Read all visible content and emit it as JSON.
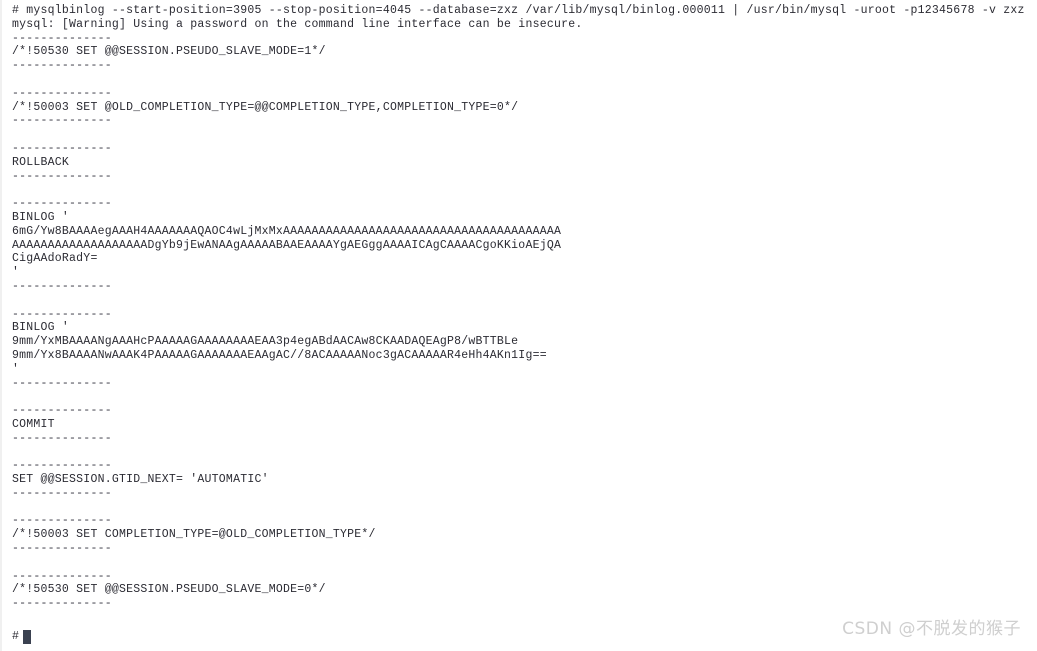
{
  "terminal": {
    "background_color": "#ffffff",
    "text_color": "#2b2b33",
    "cursor_color": "#3a4150",
    "prompt_symbol": "#",
    "lines": [
      "# mysqlbinlog --start-position=3905 --stop-position=4045 --database=zxz /var/lib/mysql/binlog.000011 | /usr/bin/mysql -uroot -p12345678 -v zxz",
      "mysql: [Warning] Using a password on the command line interface can be insecure.",
      "--------------",
      "/*!50530 SET @@SESSION.PSEUDO_SLAVE_MODE=1*/",
      "--------------",
      "",
      "--------------",
      "/*!50003 SET @OLD_COMPLETION_TYPE=@@COMPLETION_TYPE,COMPLETION_TYPE=0*/",
      "--------------",
      "",
      "--------------",
      "ROLLBACK",
      "--------------",
      "",
      "--------------",
      "BINLOG '",
      "6mG/Yw8BAAAAegAAAH4AAAAAAAQAOC4wLjMxMxAAAAAAAAAAAAAAAAAAAAAAAAAAAAAAAAAAAAAAA",
      "AAAAAAAAAAAAAAAAAAADgYb9jEwANAAgAAAAABAAEAAAAYgAEGggAAAAICAgCAAAACgoKKioAEjQA",
      "CigAAdoRadY=",
      "'",
      "--------------",
      "",
      "--------------",
      "BINLOG '",
      "9mm/YxMBAAAANgAAAHcPAAAAAGAAAAAAAAEAA3p4egABdAACAw8CKAADAQEAgP8/wBTTBLe",
      "9mm/Yx8BAAAANwAAAK4PAAAAAGAAAAAAAEAAgAC//8ACAAAAANoc3gACAAAAAR4eHh4AKn1Ig==",
      "'",
      "--------------",
      "",
      "--------------",
      "COMMIT",
      "--------------",
      "",
      "--------------",
      "SET @@SESSION.GTID_NEXT= 'AUTOMATIC'",
      "--------------",
      "",
      "--------------",
      "/*!50003 SET COMPLETION_TYPE=@OLD_COMPLETION_TYPE*/",
      "--------------",
      "",
      "--------------",
      "/*!50530 SET @@SESSION.PSEUDO_SLAVE_MODE=0*/",
      "--------------"
    ]
  },
  "watermark": {
    "text": "CSDN @不脱发的猴子",
    "color": "#cfcfcf"
  }
}
